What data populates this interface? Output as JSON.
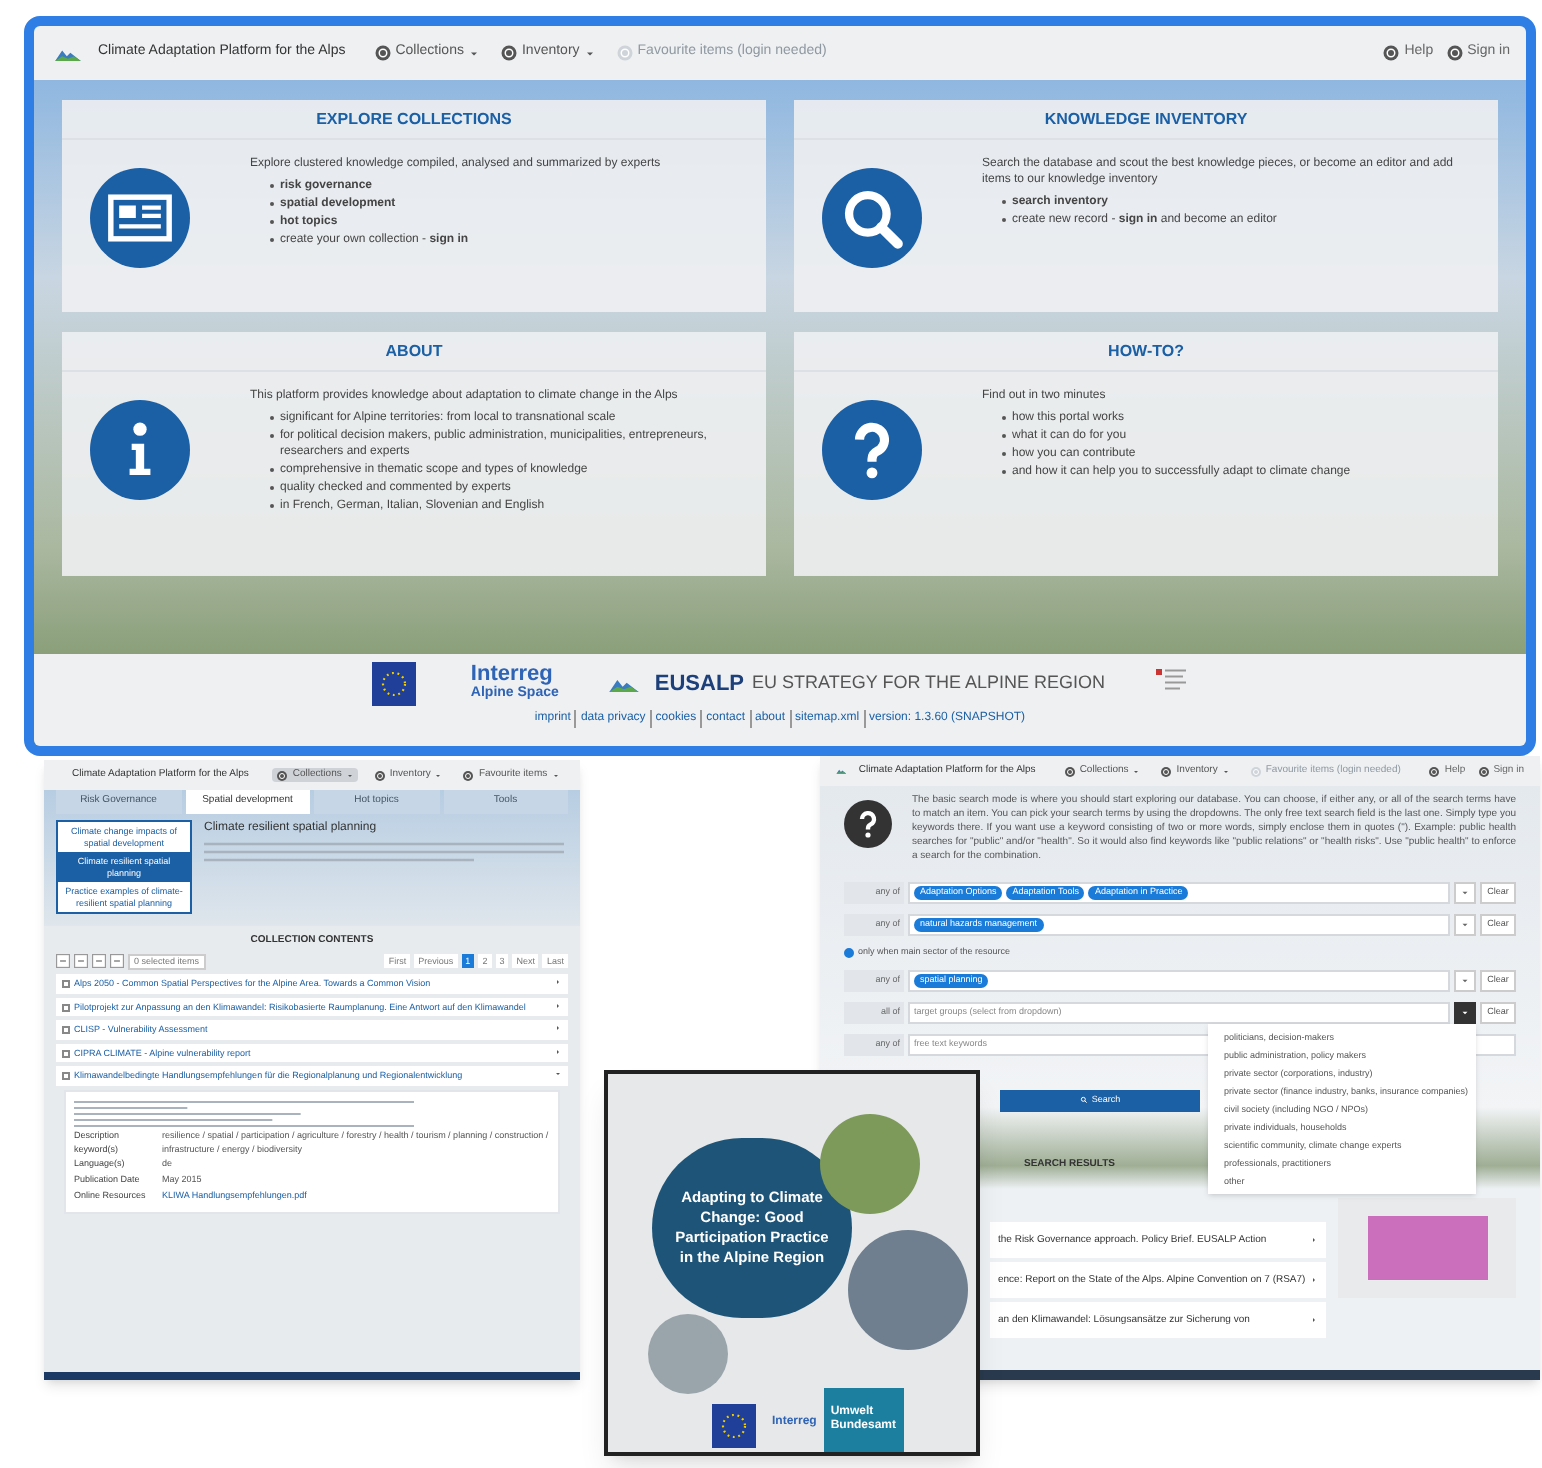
{
  "main_window": {
    "header": {
      "title": "Climate Adaptation Platform for the Alps",
      "nav": [
        {
          "label": "Collections",
          "disabled": false
        },
        {
          "label": "Inventory",
          "disabled": false
        },
        {
          "label": "Favourite items (login needed)",
          "disabled": true
        }
      ],
      "right": [
        "Help",
        "Sign in"
      ]
    },
    "panels": [
      {
        "title": "EXPLORE COLLECTIONS",
        "intro": "Explore clustered knowledge compiled, analysed and summarized by experts",
        "items": [
          "**risk governance**",
          "**spatial development**",
          "**hot topics**",
          "create your own collection - **sign in**"
        ]
      },
      {
        "title": "KNOWLEDGE INVENTORY",
        "intro": "Search the database and scout the best knowledge pieces, or become an editor and add items to our knowledge inventory",
        "items": [
          "**search inventory**",
          "create new record - **sign in** and become an editor"
        ]
      },
      {
        "title": "ABOUT",
        "intro": "This platform provides knowledge about adaptation to climate change in the Alps",
        "items": [
          "significant for Alpine territories: from local to transnational scale",
          "for political decision makers, public administration, municipalities, entrepreneurs, researchers and experts",
          "comprehensive in thematic scope and types of knowledge",
          "quality checked and commented by experts",
          "in French, German, Italian, Slovenian and English"
        ]
      },
      {
        "title": "HOW-TO?",
        "intro": "Find out in two minutes",
        "items": [
          "how this portal works",
          "what it can do for you",
          "how you can contribute",
          "and how it can help you to successfully adapt to climate change"
        ]
      }
    ],
    "footer": {
      "interreg": "Interreg",
      "interreg_sub": "Alpine Space",
      "eusalp": "EUSALP",
      "eusalp_sub": "EU STRATEGY FOR THE ALPINE REGION",
      "links": [
        "imprint",
        "data privacy",
        "cookies",
        "contact",
        "about",
        "sitemap.xml",
        "version: 1.3.60 (SNAPSHOT)"
      ]
    }
  },
  "collection_window": {
    "header": {
      "title": "Climate Adaptation Platform for the Alps",
      "nav": [
        {
          "label": "Collections",
          "selected": true
        },
        {
          "label": "Inventory",
          "selected": false
        },
        {
          "label": "Favourite items",
          "selected": false
        }
      ]
    },
    "tabs": [
      {
        "label": "Risk Governance",
        "selected": false
      },
      {
        "label": "Spatial development",
        "selected": true
      },
      {
        "label": "Hot topics",
        "selected": false
      },
      {
        "label": "Tools",
        "selected": false
      }
    ],
    "menu": [
      {
        "label": "Climate change impacts of spatial development",
        "selected": false
      },
      {
        "label": "Climate resilient spatial planning",
        "selected": true
      },
      {
        "label": "Practice examples of climate-resilient spatial planning",
        "selected": false
      }
    ],
    "topic_title": "Climate resilient spatial planning",
    "contents_heading": "COLLECTION CONTENTS",
    "selection_button": "0 selected items",
    "pagination": [
      {
        "label": "First",
        "selected": false
      },
      {
        "label": "Previous",
        "selected": false
      },
      {
        "label": "1",
        "selected": true
      },
      {
        "label": "2",
        "selected": false
      },
      {
        "label": "3",
        "selected": false
      },
      {
        "label": "Next",
        "selected": false
      },
      {
        "label": "Last",
        "selected": false
      }
    ],
    "items": [
      {
        "title": "Alps 2050 - Common Spatial Perspectives for the Alpine Area. Towards a Common Vision",
        "expanded": false
      },
      {
        "title": "Pilotprojekt zur Anpassung an den Klimawandel: Risikobasierte Raumplanung. Eine Antwort auf den Klimawandel",
        "expanded": false
      },
      {
        "title": "CLISP - Vulnerability Assessment",
        "expanded": false
      },
      {
        "title": "CIPRA CLIMATE - Alpine vulnerability report",
        "expanded": false
      },
      {
        "title": "Klimawandelbedingte Handlungsempfehlungen für die Regionalplanung und Regionalentwicklung",
        "expanded": true
      }
    ],
    "details": [
      {
        "label": "Description keyword(s)",
        "value": "resilience / spatial / participation / agriculture / forestry / health / tourism / planning / construction / infrastructure / energy / biodiversity"
      },
      {
        "label": "Language(s)",
        "value": "de"
      },
      {
        "label": "Publication Date",
        "value": "May 2015"
      },
      {
        "label": "Online Resources",
        "value": "KLIWA Handlungsempfehlungen.pdf"
      }
    ]
  },
  "search_window": {
    "header": {
      "title": "Climate Adaptation Platform for the Alps",
      "nav": [
        {
          "label": "Collections",
          "disabled": false
        },
        {
          "label": "Inventory",
          "disabled": false
        },
        {
          "label": "Favourite items (login needed)",
          "disabled": true
        }
      ],
      "right": [
        "Help",
        "Sign in"
      ]
    },
    "help_text": "The basic search mode is where you should start exploring our database. You can choose, if either any, or all of the search terms have to match an item. You can pick your search terms by using the dropdowns. The only free text search field is the last one. Simply type you keywords there. If you want use a keyword consisting of two or more words, simply enclose them in quotes (\"). Example: public health searches for \"public\" and/or \"health\". So it would also find keywords like \"public relations\" or \"health risks\". Use \"public health\" to enforce a search for the combination.",
    "rows": [
      {
        "kind": "tags",
        "mode": "any of",
        "tags": [
          "Adaptation Options",
          "Adaptation Tools",
          "Adaptation in Practice"
        ],
        "clear": "Clear"
      },
      {
        "kind": "tags",
        "mode": "any of",
        "tags": [
          "natural hazards management"
        ],
        "clear": "Clear"
      },
      {
        "kind": "checkbox",
        "label": "only when main sector of the resource",
        "checked": true
      },
      {
        "kind": "tags",
        "mode": "any of",
        "tags": [
          "spatial planning"
        ],
        "clear": "Clear"
      },
      {
        "kind": "select",
        "mode": "all of",
        "placeholder": "target groups (select from dropdown)",
        "open": true,
        "clear": "Clear"
      },
      {
        "kind": "text",
        "mode": "any of",
        "placeholder": "free text keywords"
      }
    ],
    "dropdown": [
      "politicians, decision-makers",
      "public administration, policy makers",
      "private sector (corporations, industry)",
      "private sector (finance industry, banks, insurance companies)",
      "civil society (including NGO / NPOs)",
      "private individuals, households",
      "scientific community, climate change experts",
      "professionals, practitioners",
      "other"
    ],
    "search_button": "Search",
    "results_heading": "SEARCH RESULTS",
    "results": [
      "the Risk Governance approach. Policy Brief. EUSALP Action",
      "ence: Report on the State of the Alps. Alpine Convention on 7 (RSA7)",
      "an den Klimawandel: Lösungsansätze zur Sicherung von"
    ]
  },
  "brochure": {
    "title": "Adapting to Climate Change: Good Participation Practice in the Alpine Region",
    "interreg": "Interreg",
    "publisher": "Umwelt Bundesamt"
  }
}
